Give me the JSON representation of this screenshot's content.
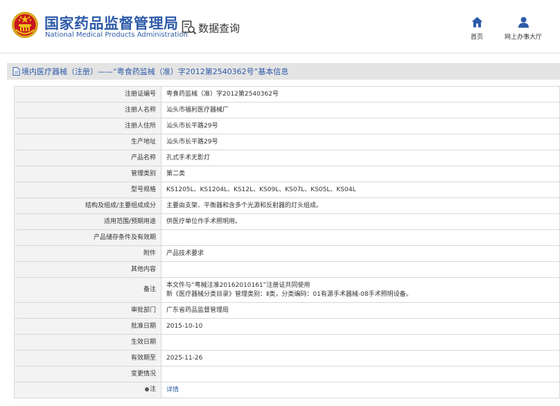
{
  "header": {
    "title_cn": "国家药品监督管理局",
    "title_en": "National Medical Products Administration",
    "query_label": "数据查询",
    "nav_home": "首页",
    "nav_service": "网上办事大厅"
  },
  "page": {
    "title": "境内医疗器械（注册）——“粤食药监械（准）字2012第2540362号”基本信息"
  },
  "record": {
    "reg_no_label": "注册证编号",
    "reg_no": "粤食药监械（准）字2012第2540362号",
    "registrant_label": "注册人名称",
    "registrant": "汕头市福利医疗器械厂",
    "residence_label": "注册人住所",
    "residence": "汕头市长平路29号",
    "production_label": "生产地址",
    "production": "汕头市长平路29号",
    "product_name_label": "产品名称",
    "product_name": "孔式手术无影灯",
    "category_label": "管理类别",
    "category": "第二类",
    "model_label": "型号规格",
    "model": "KS1205L、KS1204L、KS12L、KS09L、KS07L、KS05L、KS04L",
    "structure_label": "结构及组成/主要组成成分",
    "structure": "主要由支架、平衡器和含多个光源和反射器的灯头组成。",
    "scope_label": "适用范围/预期用途",
    "scope": "供医疗单位作手术照明用。",
    "storage_label": "产品储存条件及有效期",
    "storage": "",
    "attachment_label": "附件",
    "attachment": "产品技术要求",
    "other_label": "其他内容",
    "other": "",
    "remarks_label": "备注",
    "remarks_line1": "本文件与“粤械注准20162010161”注册证共同使用",
    "remarks_line2": "新《医疗器械分类目录》管理类别：Ⅱ类，分类编码：01有源手术器械-08手术照明设备。",
    "approval_dept_label": "审批部门",
    "approval_dept": "广东省药品监督管理局",
    "approval_date_label": "批准日期",
    "approval_date": "2015-10-10",
    "effective_date_label": "生效日期",
    "effective_date": "",
    "expiry_label": "有效期至",
    "expiry": "2025-11-26",
    "change_label": "变更情况",
    "change": "",
    "note_label": "注",
    "note_link": "详情"
  },
  "colors": {
    "brand_blue": "#2d5aa8",
    "title_bar_bg": "#e4e4e4",
    "label_bg": "#f3f3f3",
    "border": "#d8d8d8"
  },
  "icons": [
    "national-emblem-icon",
    "data-query-icon",
    "home-icon",
    "user-icon",
    "document-icon",
    "dot-icon"
  ]
}
